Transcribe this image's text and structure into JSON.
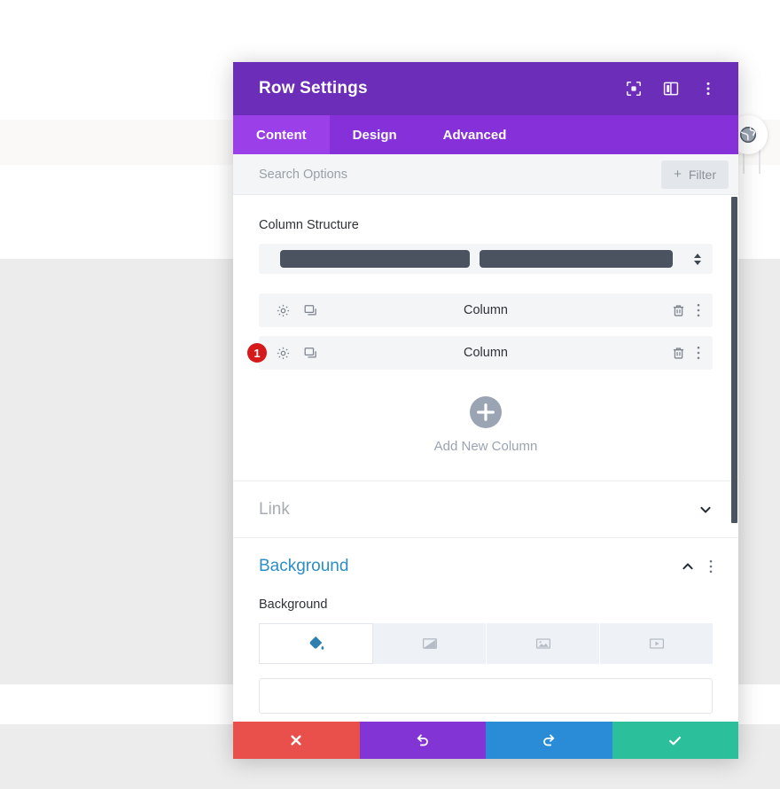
{
  "window": {
    "title": "Row Settings",
    "header_icons": [
      {
        "name": "focus-target-icon",
        "label": "Focus"
      },
      {
        "name": "layout-panel-icon",
        "label": "Layout"
      },
      {
        "name": "kebab-menu-icon",
        "label": "More options"
      }
    ]
  },
  "tabs": [
    {
      "id": "content",
      "label": "Content",
      "active": true
    },
    {
      "id": "design",
      "label": "Design",
      "active": false
    },
    {
      "id": "advanced",
      "label": "Advanced",
      "active": false
    }
  ],
  "search": {
    "placeholder": "Search Options",
    "value": "",
    "filter_label": "Filter",
    "filter_plus": "+"
  },
  "column_structure": {
    "label": "Column Structure",
    "bars": [
      {
        "name": "column-bar-1",
        "width_pct": 49
      },
      {
        "name": "column-bar-2",
        "width_pct": 51
      }
    ]
  },
  "columns": [
    {
      "name": "Column",
      "badge": null
    },
    {
      "name": "Column",
      "badge": "1"
    }
  ],
  "column_row_icons": {
    "settings": "gear-icon",
    "duplicate": "duplicate-icon",
    "delete": "trash-icon",
    "more": "kebab-menu-icon"
  },
  "add_column": {
    "label": "Add New Column",
    "plus": "+"
  },
  "sections": [
    {
      "id": "link",
      "title": "Link",
      "state": "collapsed",
      "has_kebab": false
    },
    {
      "id": "background",
      "title": "Background",
      "state": "expanded",
      "has_kebab": true
    }
  ],
  "background": {
    "field_label": "Background",
    "types": [
      {
        "id": "color",
        "icon": "paint-bucket-icon",
        "active": true
      },
      {
        "id": "gradient",
        "icon": "gradient-icon",
        "active": false
      },
      {
        "id": "image",
        "icon": "image-icon",
        "active": false
      },
      {
        "id": "video",
        "icon": "video-icon",
        "active": false
      }
    ]
  },
  "actions": [
    {
      "id": "close",
      "icon": "close-x-icon",
      "color": "#e9504b"
    },
    {
      "id": "undo",
      "icon": "undo-icon",
      "color": "#8334d4"
    },
    {
      "id": "redo",
      "icon": "redo-icon",
      "color": "#2a8bd6"
    },
    {
      "id": "save",
      "icon": "checkmark-icon",
      "color": "#2cbf9c"
    }
  ],
  "colors": {
    "header_purple": "#6c2eb9",
    "tabs_purple": "#8630d9",
    "tab_active_purple": "#9b3fe8",
    "badge_red": "#d61919",
    "section_blue": "#2d8ec4",
    "bar_slate": "#4a535f"
  },
  "page_background": {
    "globe_badge": "globe-icon"
  }
}
